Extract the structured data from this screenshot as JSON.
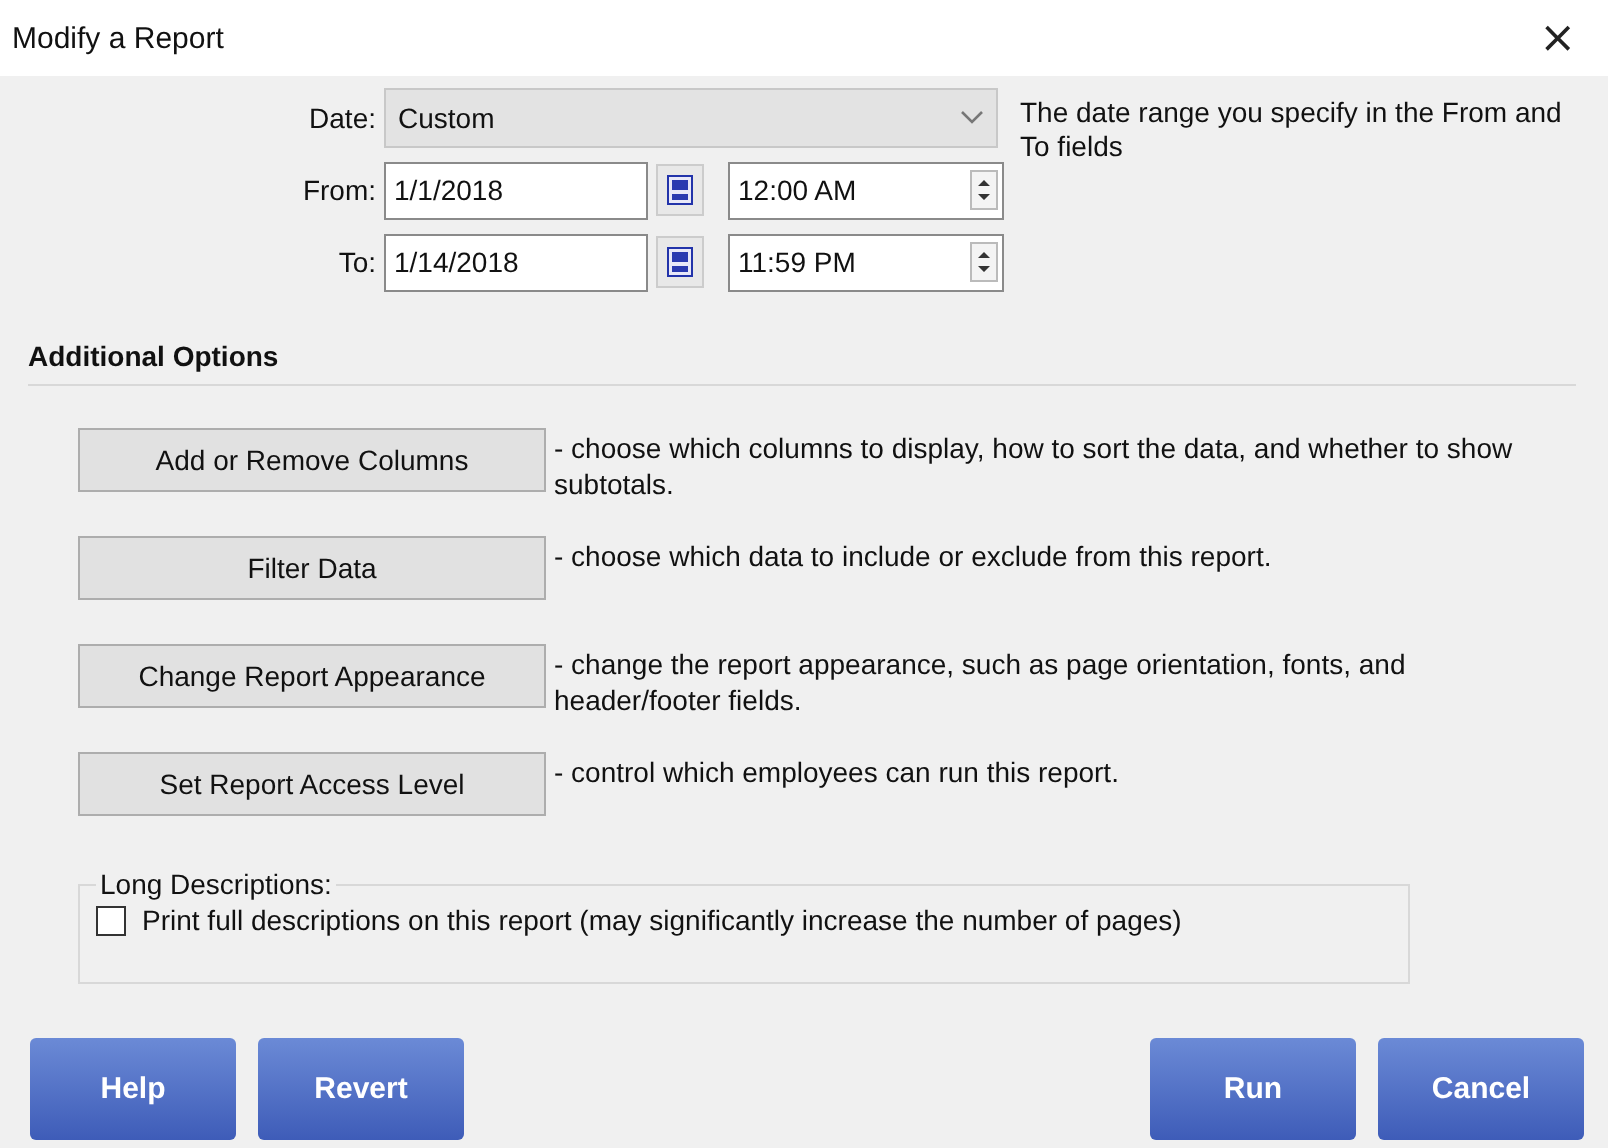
{
  "window": {
    "title": "Modify a Report",
    "close": "×"
  },
  "date": {
    "label": "Date:",
    "value": "Custom",
    "hint": "The date range you specify in the From and To fields"
  },
  "range": [
    {
      "label": "From:",
      "date": "1/1/2018",
      "time": "12:00 AM"
    },
    {
      "label": "To:",
      "date": "1/14/2018",
      "time": "11:59 PM"
    }
  ],
  "section_title": "Additional Options",
  "options": [
    {
      "button": "Add or Remove Columns",
      "description": "- choose which columns to display, how to sort the data, and whether to show subtotals."
    },
    {
      "button": "Filter Data",
      "description": "- choose which data to include or exclude from this report."
    },
    {
      "button": "Change Report Appearance",
      "description": "- change the report appearance, such as page orientation, fonts, and header/footer fields."
    },
    {
      "button": "Set Report Access Level",
      "description": "- control which employees can run this report."
    }
  ],
  "long_descriptions": {
    "legend": "Long Descriptions:",
    "label": "Print full descriptions on this report (may significantly increase the number of pages)",
    "checked": false
  },
  "buttons_left": [
    "Help",
    "Revert"
  ],
  "buttons_right": [
    "Run",
    "Cancel"
  ]
}
